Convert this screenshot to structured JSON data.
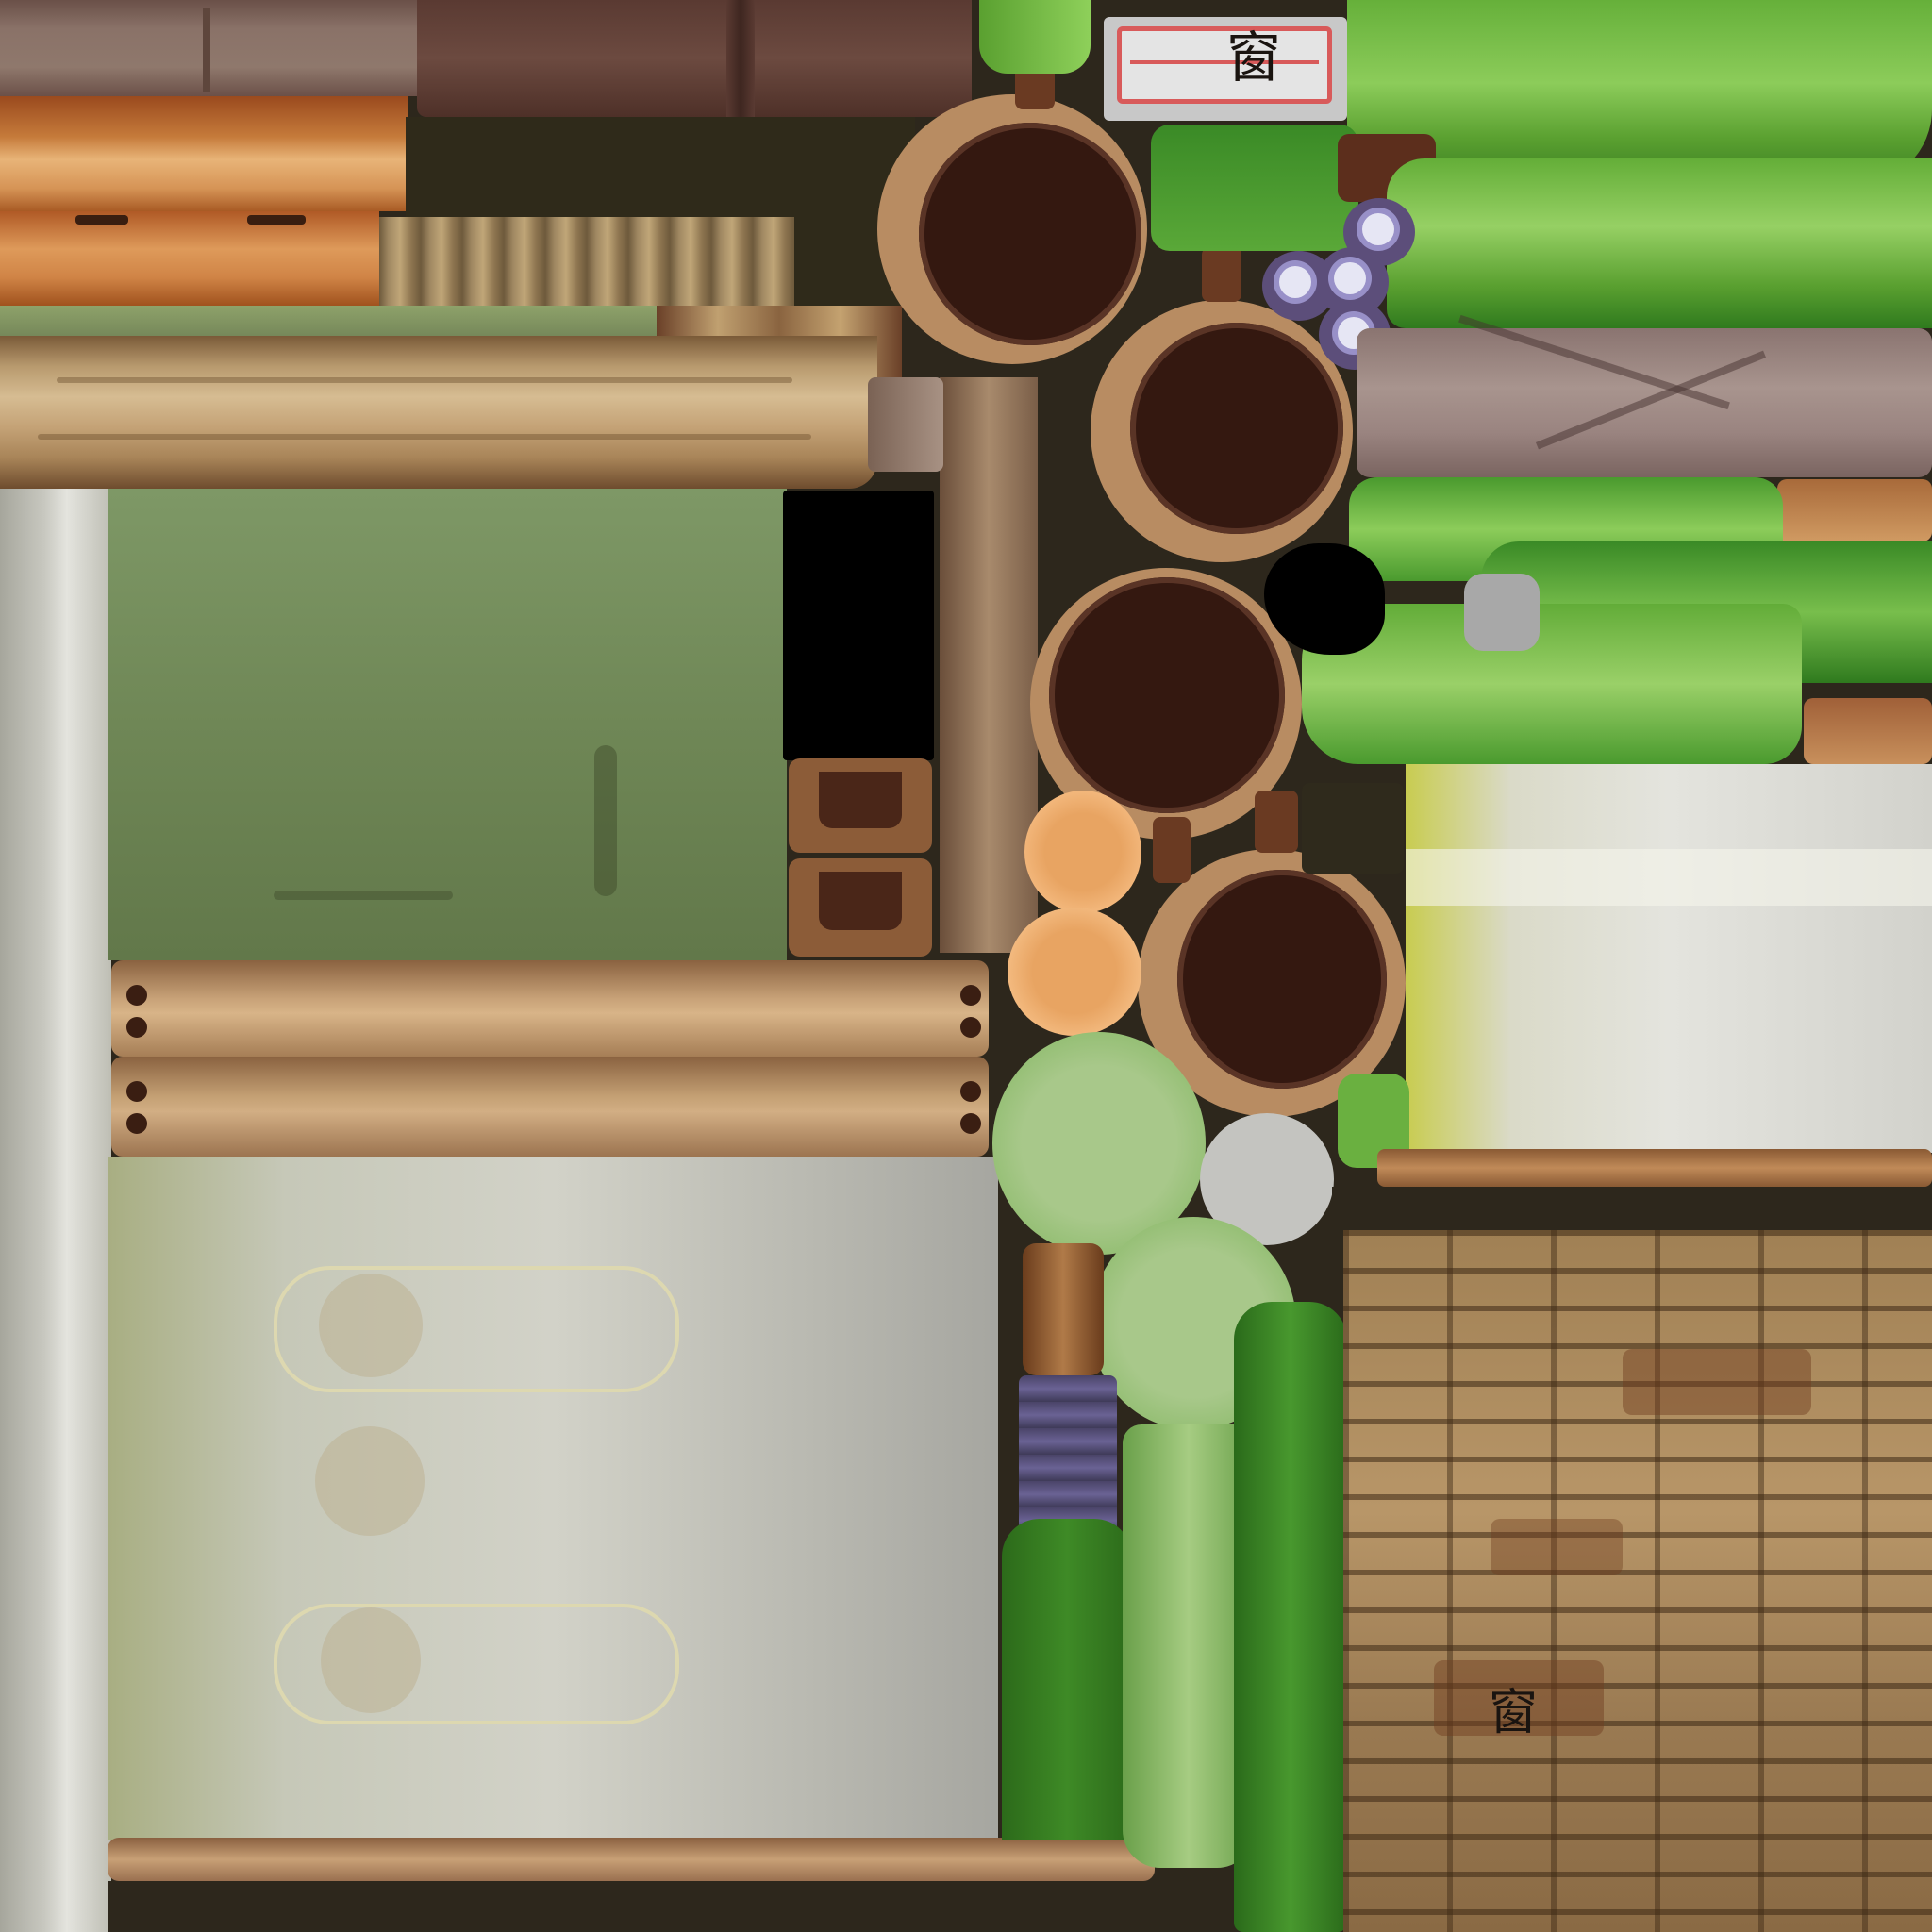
{
  "atlas": {
    "kind": "texture-atlas",
    "text_marks": [
      "窗",
      "窗"
    ],
    "colors": {
      "background_dark": "#2d271c",
      "wood_dark": "#5a3a30",
      "wood_light": "#c79a66",
      "wood_orange": "#b8652c",
      "pot_interior": "#341810",
      "pot_rim": "#b88c62",
      "leaf_green": "#5aa032",
      "leaf_dark": "#2f7a1e",
      "moss_panel": "#6e8553",
      "pale_panel": "#c2c4b8",
      "pale_green": "#a2c486",
      "peach": "#eda868",
      "lilac": "#9890c8",
      "black": "#000000",
      "label_red": "#d85a5a"
    },
    "icons": [
      "wood-plank",
      "clay-pot",
      "leaf",
      "flower",
      "brick-wall",
      "paper-label"
    ]
  }
}
